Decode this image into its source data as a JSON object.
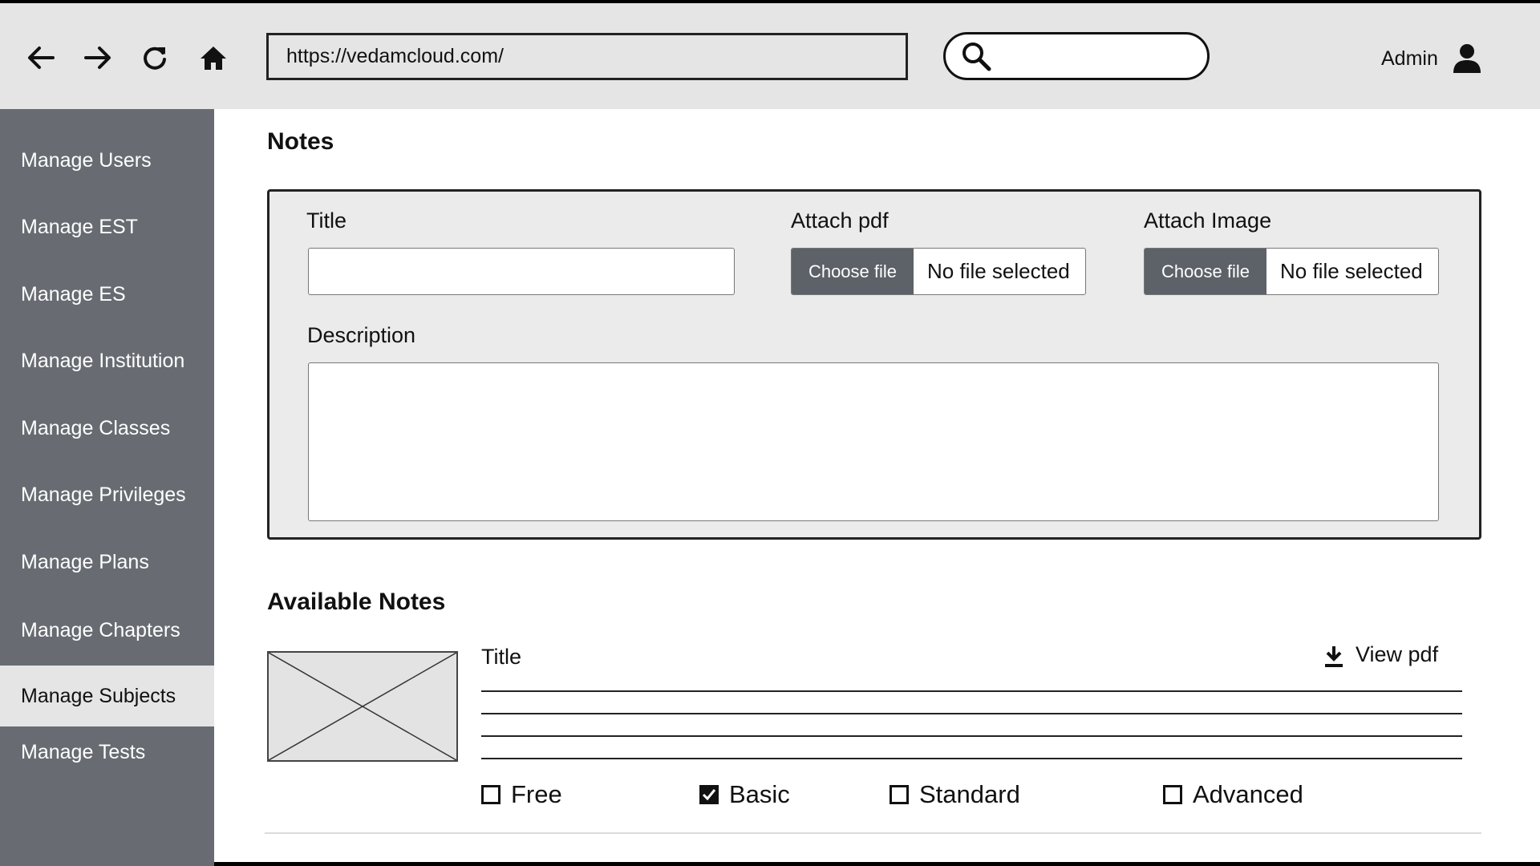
{
  "browser": {
    "url": "https://vedamcloud.com/",
    "search_value": "",
    "user_label": "Admin"
  },
  "sidebar": {
    "items": [
      {
        "label": "Manage Users"
      },
      {
        "label": "Manage EST"
      },
      {
        "label": "Manage ES"
      },
      {
        "label": "Manage Institution"
      },
      {
        "label": "Manage Classes"
      },
      {
        "label": "Manage Privileges"
      },
      {
        "label": "Manage Plans"
      },
      {
        "label": "Manage Chapters"
      },
      {
        "label": "Manage Subjects",
        "active": true
      },
      {
        "label": "Manage Tests"
      }
    ]
  },
  "notes_form": {
    "heading": "Notes",
    "title_label": "Title",
    "title_value": "",
    "pdf_label": "Attach pdf",
    "pdf_button": "Choose file",
    "pdf_status": "No file selected",
    "image_label": "Attach Image",
    "image_button": "Choose file",
    "image_status": "No file selected",
    "description_label": "Description",
    "description_value": ""
  },
  "available_notes": {
    "heading": "Available Notes",
    "item": {
      "title": "Title",
      "view_label": "View pdf",
      "plans": [
        {
          "label": "Free",
          "checked": false
        },
        {
          "label": "Basic",
          "checked": true
        },
        {
          "label": "Standard",
          "checked": false
        },
        {
          "label": "Advanced",
          "checked": false
        }
      ]
    }
  },
  "icons": {
    "back": "arrow-left-icon",
    "forward": "arrow-right-icon",
    "reload": "reload-icon",
    "home": "home-icon",
    "search": "search-icon",
    "user": "user-icon",
    "download": "download-icon",
    "placeholder_image": "image-placeholder-icon"
  },
  "colors": {
    "sidebar_bg": "#686c72",
    "sidebar_active_bg": "#e5e5e5",
    "browser_bar_bg": "#e5e5e5",
    "file_button_bg": "#5d6168"
  }
}
